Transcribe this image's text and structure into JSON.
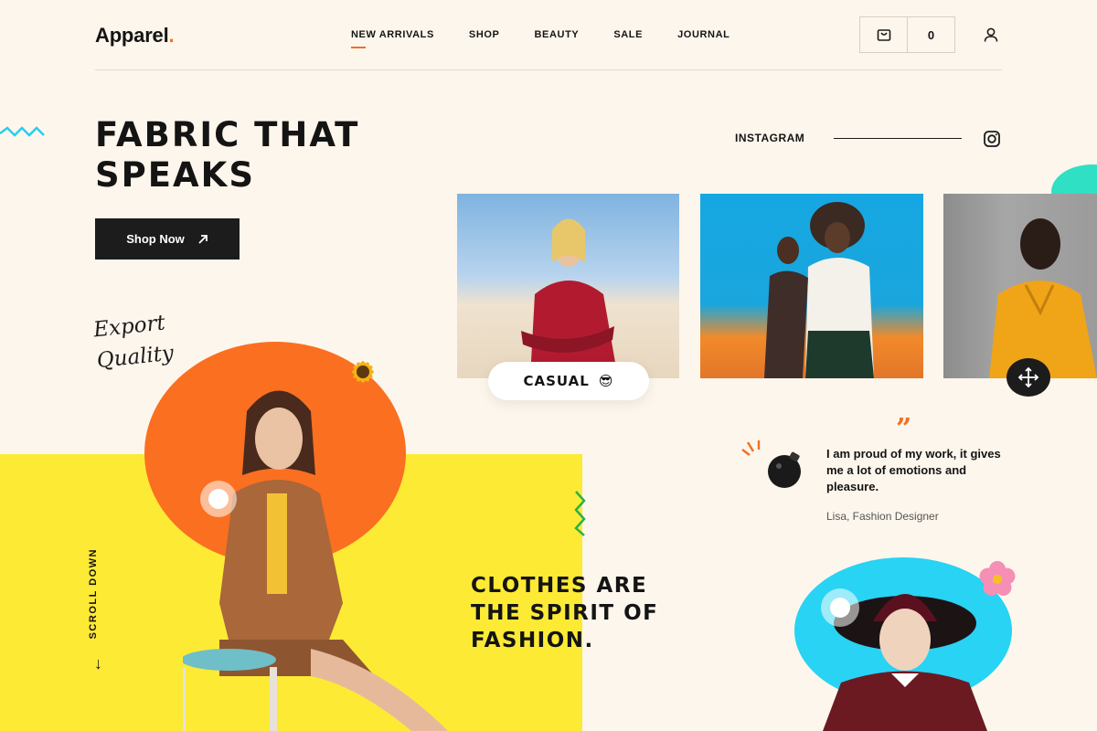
{
  "brand": {
    "name": "Apparel",
    "dot": "."
  },
  "nav": {
    "items": [
      {
        "label": "NEW ARRIVALS",
        "active": true
      },
      {
        "label": "SHOP",
        "active": false
      },
      {
        "label": "BEAUTY",
        "active": false
      },
      {
        "label": "SALE",
        "active": false
      },
      {
        "label": "JOURNAL",
        "active": false
      }
    ]
  },
  "cart": {
    "count": "0",
    "icon": "shopping-bag-icon"
  },
  "hero": {
    "title": "FABRIC THAT\nSPEAKS",
    "cta_label": "Shop Now"
  },
  "instagram": {
    "label": "INSTAGRAM",
    "icon": "instagram-icon"
  },
  "gallery": {
    "casual_label": "CASUAL",
    "casual_emoji": "😎"
  },
  "script_text": "Export\n   Quality",
  "scroll": {
    "label": "SCROLL DOWN",
    "arrow": "↓"
  },
  "tagline": "CLOTHES ARE\nTHE SPIRIT OF\nFASHION.",
  "quote": {
    "mark": "”",
    "text": "I am proud of my work, it gives me a lot of emotions and pleasure.",
    "author": "Lisa, Fashion Designer"
  },
  "colors": {
    "accent": "#f26f21",
    "yellow": "#fdea35",
    "orange": "#fb6f21",
    "cyan": "#28d3f3",
    "teal": "#2fe0c5",
    "background": "#fdf6ec"
  }
}
